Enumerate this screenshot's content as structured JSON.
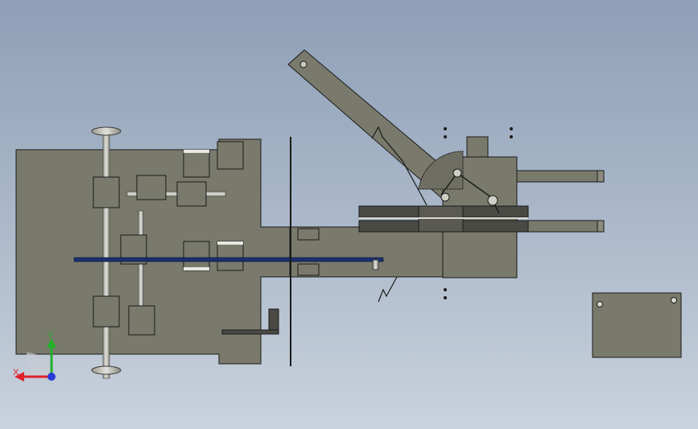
{
  "viewport": {
    "background_top": "#8e9fb7",
    "background_bottom": "#c9d2dd",
    "part_color": "#7a7a6c",
    "edge_color": "#1a1a1a"
  },
  "triad": {
    "x_label": "X",
    "y_label": "Y",
    "x_color": "#e0202a",
    "y_color": "#22b02a",
    "z_color": "#2a3ad8"
  }
}
